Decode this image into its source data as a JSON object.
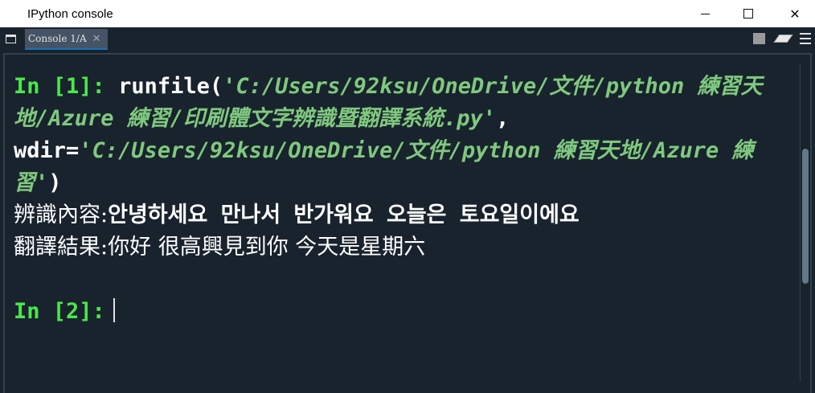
{
  "window": {
    "title": "IPython console",
    "minimize_icon": "minimize-icon",
    "maximize_icon": "maximize-icon",
    "close_label": "✕"
  },
  "tabbar": {
    "tab_label": "Console 1/A",
    "tab_close": "✕",
    "icons": [
      "undock-icon",
      "stop-icon",
      "eraser-icon",
      "hamburger-menu-icon"
    ]
  },
  "console": {
    "in1_prompt": "In [1]:",
    "in1_func": "runfile(",
    "in1_path": "'C:/Users/92ksu/OneDrive/文件/python 練習天地/Azure 練習/印刷體文字辨識暨翻譯系統.py'",
    "in1_sep": ", wdir=",
    "in1_wdir": "'C:/Users/92ksu/OneDrive/文件/python 練習天地/Azure 練習'",
    "in1_close": ")",
    "out1_label": "辨識內容:",
    "out1_value": "안녕하세요 만나서 반가워요 오늘은 토요일이에요",
    "out2_label": "翻譯結果:",
    "out2_value": "你好 很高興見到你 今天是星期六",
    "in2_prompt": "In [2]:"
  },
  "colors": {
    "background": "#19232d",
    "prompt": "#4be84b",
    "string": "#7fc97f",
    "tab_bg": "#455364",
    "tab_accent": "#1a72bb"
  }
}
